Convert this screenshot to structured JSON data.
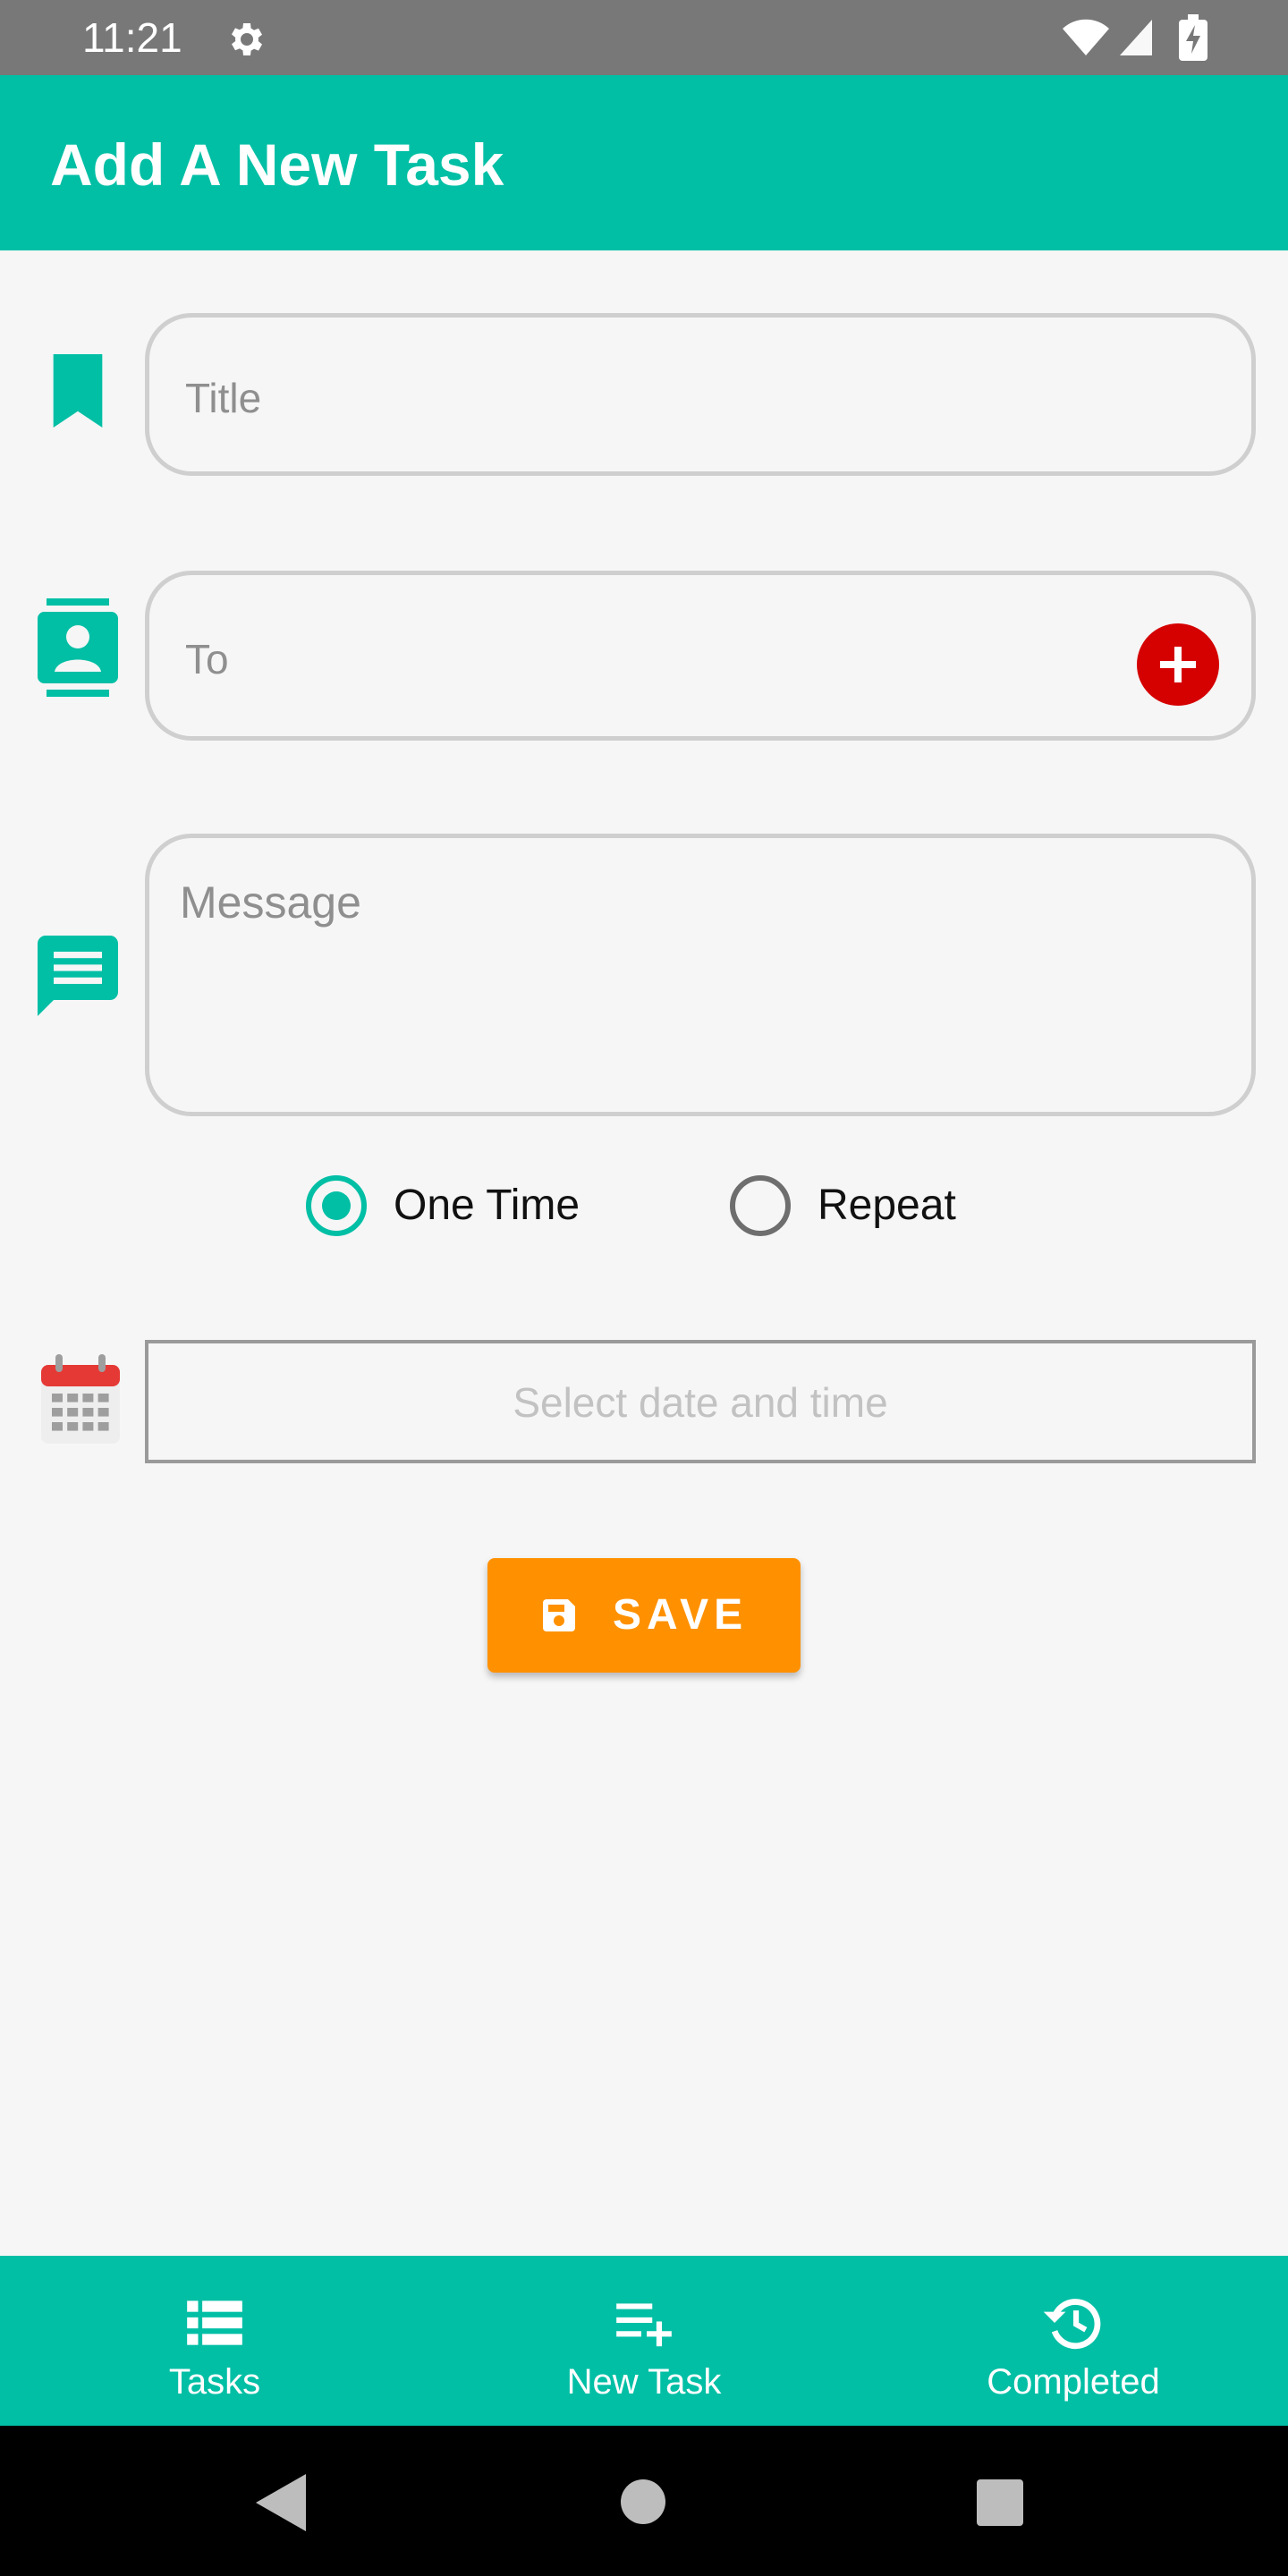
{
  "status_bar": {
    "time": "11:21",
    "icons": [
      "gear-icon",
      "wifi-icon",
      "signal-icon",
      "battery-charging-icon"
    ]
  },
  "app_bar": {
    "title": "Add A New Task"
  },
  "form": {
    "title_placeholder": "Title",
    "to_placeholder": "To",
    "message_placeholder": "Message",
    "schedule_options": [
      {
        "label": "One Time",
        "selected": true
      },
      {
        "label": "Repeat",
        "selected": false
      }
    ],
    "date_placeholder": "Select date and time",
    "save_label": "SAVE",
    "icons": [
      "bookmark-icon",
      "contact-icon",
      "message-icon",
      "add-circle-icon",
      "calendar-icon",
      "save-icon"
    ]
  },
  "bottom_nav": {
    "items": [
      {
        "label": "Tasks",
        "icon": "list-icon"
      },
      {
        "label": "New Task",
        "icon": "playlist-add-icon"
      },
      {
        "label": "Completed",
        "icon": "history-icon"
      }
    ]
  },
  "colors": {
    "primary": "#00bfa5",
    "accent_button": "#ff9100",
    "add_button": "#d50000",
    "status_bar": "#787878",
    "background": "#f6f6f6"
  }
}
